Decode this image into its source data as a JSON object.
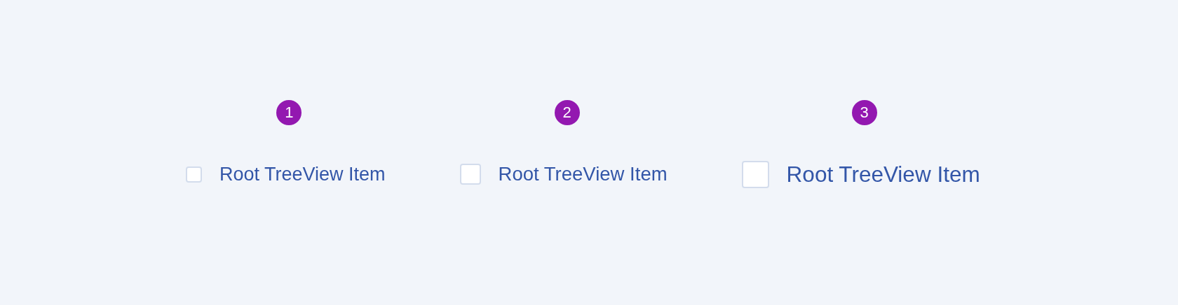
{
  "examples": [
    {
      "badge": "1",
      "kind": "small",
      "checked": false,
      "label": "Root TreeView Item"
    },
    {
      "badge": "2",
      "kind": "medium",
      "checked": false,
      "label": "Root TreeView Item"
    },
    {
      "badge": "3",
      "kind": "large",
      "checked": false,
      "label": "Root TreeView Item"
    }
  ]
}
